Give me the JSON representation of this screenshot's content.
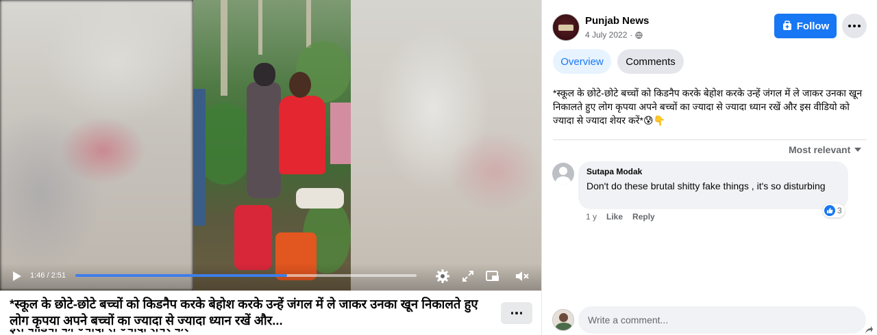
{
  "video": {
    "time_label": "1:46 / 2:51",
    "progress_fraction": 0.62,
    "caption": "*स्कूल के छोटे-छोटे बच्चों को किडनैप करके बेहोश करके उन्हें जंगल में ले जाकर उनका खून निकालते हुए लोग कृपया अपने बच्चों का ज्यादा से ज्यादा ध्यान रखें और...",
    "caption_next_line": "इस वीडियो को ज्यादा से ज्यादा शेयर करें*",
    "icons": {
      "play": "play-icon",
      "settings": "gear-icon",
      "expand": "expand-icon",
      "pip": "picture-in-picture-icon",
      "volume": "volume-muted-icon",
      "more": "more-horizontal-icon"
    }
  },
  "post": {
    "page_name": "Punjab News",
    "date": "4 July 2022",
    "privacy_icon": "globe-icon",
    "follow_label": "Follow",
    "tabs": [
      {
        "label": "Overview",
        "active": true
      },
      {
        "label": "Comments",
        "active": false
      }
    ],
    "text": "*स्कूल के छोटे-छोटे बच्चों को किडनैप करके बेहोश करके उन्हें जंगल में ले जाकर उनका खून निकालते हुए लोग कृपया अपने बच्चों का ज्यादा से ज्यादा ध्यान रखें और इस वीडियो को ज्यादा से ज्यादा शेयर करें*😰👇",
    "sort_label": "Most relevant"
  },
  "comments": [
    {
      "author": "Sutapa Modak",
      "text": "Don't do these brutal shitty fake things , it's so disturbing",
      "age": "1 y",
      "like_label": "Like",
      "reply_label": "Reply",
      "reaction_count": "3",
      "reaction_icon": "like-icon"
    }
  ],
  "composer": {
    "placeholder": "Write a comment..."
  },
  "colors": {
    "accent": "#1877f2",
    "progress": "#3e7ee9",
    "tab_active_bg": "#e7f3ff",
    "chip_bg": "#e4e6eb",
    "bubble_bg": "#f0f2f5"
  }
}
